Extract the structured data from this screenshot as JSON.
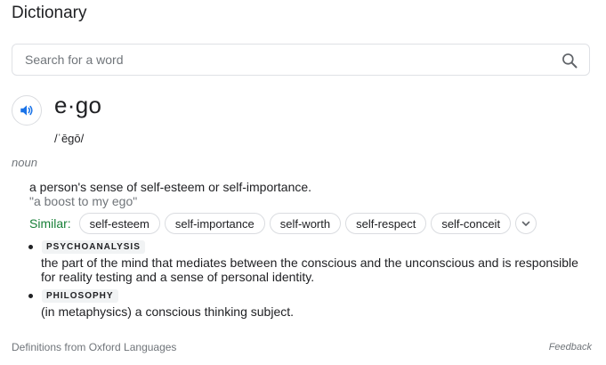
{
  "header": {
    "title": "Dictionary"
  },
  "search": {
    "placeholder": "Search for a word"
  },
  "entry": {
    "word": "e·go",
    "phonetic": "/ˈēɡō/",
    "part_of_speech": "noun",
    "definition": "a person's sense of self-esteem or self-importance.",
    "example": "\"a boost to my ego\"",
    "similar_label": "Similar:",
    "similar": [
      "self-esteem",
      "self-importance",
      "self-worth",
      "self-respect",
      "self-conceit"
    ],
    "senses": [
      {
        "domain": "PSYCHOANALYSIS",
        "text_line1": "the part of the mind that mediates between the conscious and the unconscious and is responsible",
        "text_line2": "for reality testing and a sense of personal identity."
      },
      {
        "domain": "PHILOSOPHY",
        "text_line1": "(in metaphysics) a conscious thinking subject."
      }
    ]
  },
  "footer": {
    "source": "Definitions from Oxford Languages",
    "feedback": "Feedback"
  },
  "icons": {
    "search": "search-icon",
    "speaker": "speaker-icon",
    "expand": "chevron-down-icon"
  },
  "colors": {
    "similar_label": "#188038",
    "speaker_icon": "#1a73e8",
    "muted_text": "#70757a"
  }
}
